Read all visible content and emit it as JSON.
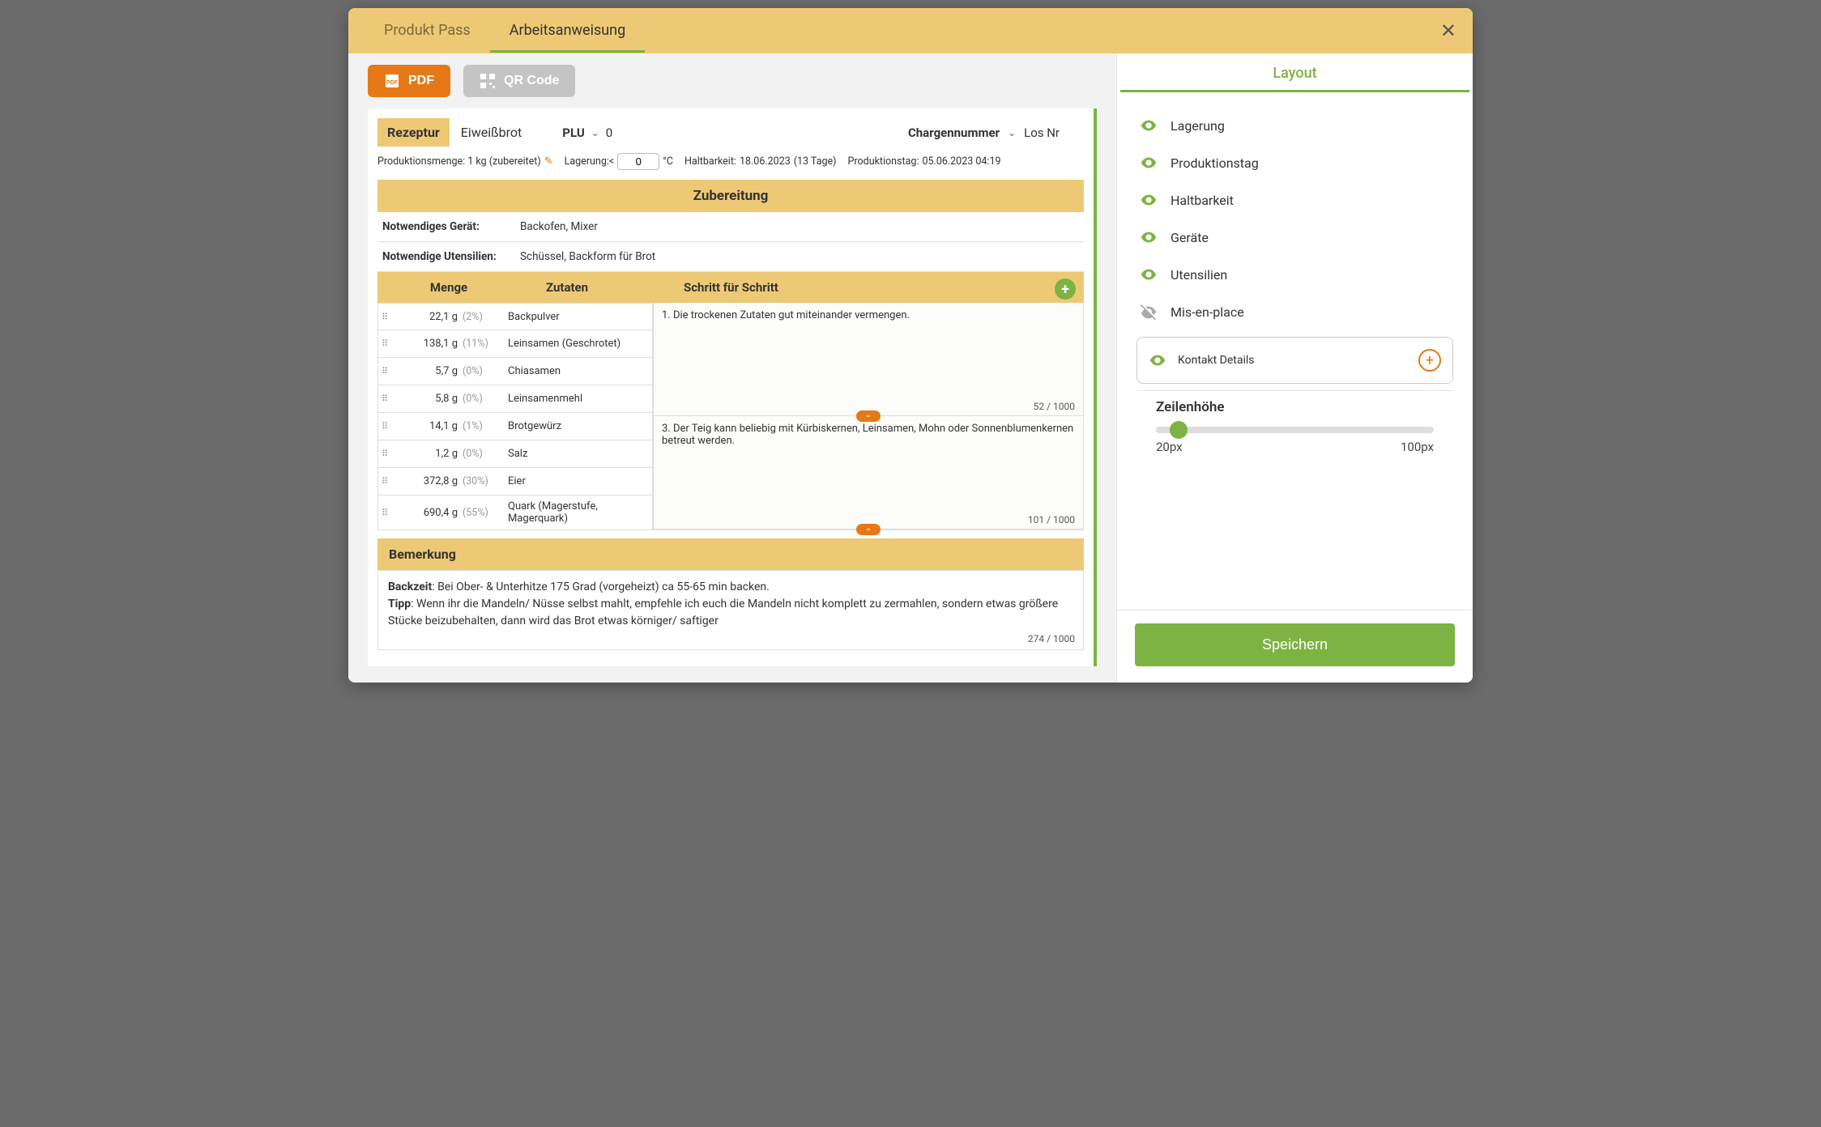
{
  "tabs": {
    "pass": "Produkt Pass",
    "work": "Arbeitsanweisung"
  },
  "toolbar": {
    "pdf": "PDF",
    "qr": "QR Code"
  },
  "recipe": {
    "label": "Rezeptur",
    "name": "Eiweißbrot",
    "plu_label": "PLU",
    "plu_value": "0",
    "charge_label": "Chargennummer",
    "charge_value": "Los Nr"
  },
  "meta": {
    "prod_amount": "Produktionsmenge: 1 kg (zubereitet)",
    "storage_label": "Lagerung:<",
    "storage_value": "0",
    "storage_unit": "°C",
    "shelf_label": "Haltbarkeit:",
    "shelf_date": "18.06.2023",
    "shelf_days": "(13 Tage)",
    "prodday_label": "Produktionstag:",
    "prodday_value": "05.06.2023 04:19"
  },
  "sections": {
    "prep": "Zubereitung",
    "remark": "Bemerkung"
  },
  "info": {
    "device_label": "Notwendiges Gerät:",
    "device_value": "Backofen, Mixer",
    "utensil_label": "Notwendige Utensilien:",
    "utensil_value": "Schüssel, Backform für Brot"
  },
  "cols": {
    "amount": "Menge",
    "ingredient": "Zutaten",
    "step": "Schritt für Schritt"
  },
  "ingredients": [
    {
      "amount": "22,1 g",
      "pct": "(2%)",
      "name": "Backpulver"
    },
    {
      "amount": "138,1 g",
      "pct": "(11%)",
      "name": "Leinsamen (Geschrotet)"
    },
    {
      "amount": "5,7 g",
      "pct": "(0%)",
      "name": "Chiasamen"
    },
    {
      "amount": "5,8 g",
      "pct": "(0%)",
      "name": "Leinsamenmehl"
    },
    {
      "amount": "14,1 g",
      "pct": "(1%)",
      "name": "Brotgewürz"
    },
    {
      "amount": "1,2 g",
      "pct": "(0%)",
      "name": "Salz"
    },
    {
      "amount": "372,8 g",
      "pct": "(30%)",
      "name": "Eier"
    },
    {
      "amount": "690,4 g",
      "pct": "(55%)",
      "name": "Quark (Magerstufe, Magerquark)"
    }
  ],
  "steps": [
    {
      "text": "1. Die trockenen Zutaten gut miteinander vermengen.",
      "counter": "52 / 1000"
    },
    {
      "text": "3. Der Teig kann beliebig mit Kürbiskernen, Leinsamen, Mohn oder Sonnenblumenkernen betreut werden.",
      "counter": "101 / 1000"
    }
  ],
  "remark": {
    "backzeit_label": "Backzeit",
    "backzeit_text": ": Bei Ober- & Unterhitze 175 Grad (vorgeheizt) ca 55-65 min backen.",
    "tipp_label": "Tipp",
    "tipp_text": ": Wenn ihr die Mandeln/ Nüsse selbst mahlt, empfehle ich euch die Mandeln nicht komplett zu zermahlen, sondern etwas größere Stücke beizubehalten, dann wird das Brot etwas körniger/ saftiger",
    "counter": "274 / 1000"
  },
  "layout": {
    "tab": "Layout",
    "items": [
      {
        "label": "Lagerung",
        "on": true
      },
      {
        "label": "Produktionstag",
        "on": true
      },
      {
        "label": "Haltbarkeit",
        "on": true
      },
      {
        "label": "Geräte",
        "on": true
      },
      {
        "label": "Utensilien",
        "on": true
      },
      {
        "label": "Mis-en-place",
        "on": false
      }
    ],
    "contact": "Kontakt Details",
    "slider_label": "Zeilenhöhe",
    "slider_min": "20px",
    "slider_max": "100px"
  },
  "save": "Speichern"
}
